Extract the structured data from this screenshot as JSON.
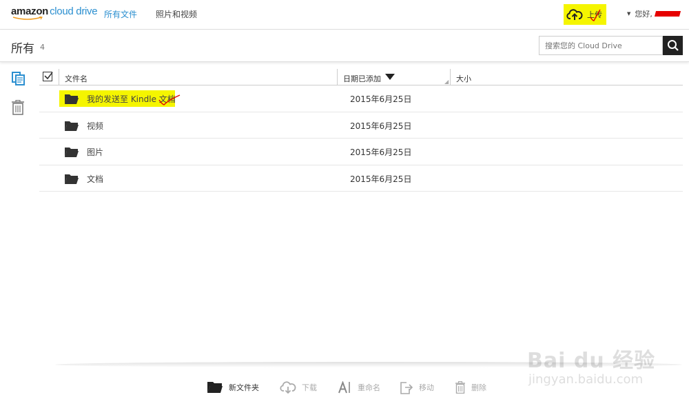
{
  "header": {
    "logo_amazon": "amazon",
    "logo_cloud_drive": "cloud drive",
    "nav": [
      {
        "label": "所有文件",
        "active": true
      },
      {
        "label": "照片和视频",
        "active": false
      }
    ],
    "upload_label": "上传",
    "greeting": "您好,"
  },
  "titlebar": {
    "title": "所有",
    "count": "4",
    "search_placeholder": "搜索您的 Cloud Drive"
  },
  "table": {
    "columns": [
      "文件名",
      "日期已添加",
      "大小"
    ],
    "rows": [
      {
        "name": "我的发送至 Kindle 文档",
        "date": "2015年6月25日",
        "highlighted": true
      },
      {
        "name": "视频",
        "date": "2015年6月25日",
        "highlighted": false
      },
      {
        "name": "图片",
        "date": "2015年6月25日",
        "highlighted": false
      },
      {
        "name": "文档",
        "date": "2015年6月25日",
        "highlighted": false
      }
    ]
  },
  "toolbar": {
    "new_folder": "新文件夹",
    "download": "下载",
    "rename": "重命名",
    "move": "移动",
    "delete": "删除"
  },
  "watermark": {
    "main": "Bai du 经验",
    "sub": "jingyan.baidu.com"
  },
  "colors": {
    "accent": "#2b8fd0",
    "highlight": "#f5f500",
    "annotation_red": "#e60000"
  }
}
